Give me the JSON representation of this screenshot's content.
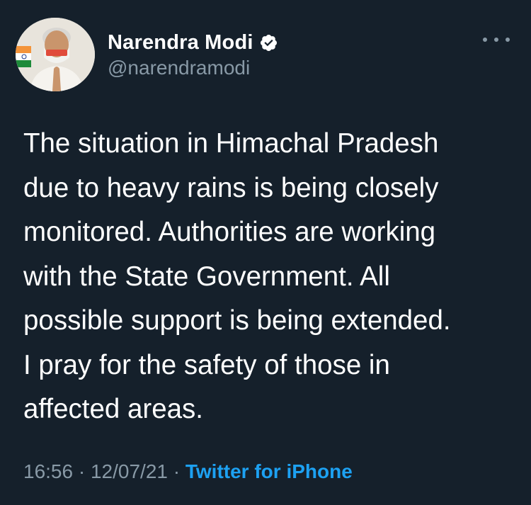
{
  "tweet": {
    "author": {
      "display_name": "Narendra Modi",
      "handle": "@narendramodi",
      "verified_icon": "verified-badge-icon"
    },
    "more_icon": "more-options-icon",
    "text": "The situation in Himachal Pradesh\ndue to heavy rains is being closely\nmonitored. Authorities are working\nwith the State Government. All\npossible support is being extended.\nI pray for the safety of those in\naffected areas.",
    "time": "16:56",
    "separator": "·",
    "date": "12/07/21",
    "source": "Twitter for iPhone"
  },
  "colors": {
    "background": "#15202b",
    "primary_text": "#ffffff",
    "secondary_text": "#8899a6",
    "accent": "#1da1f2"
  }
}
